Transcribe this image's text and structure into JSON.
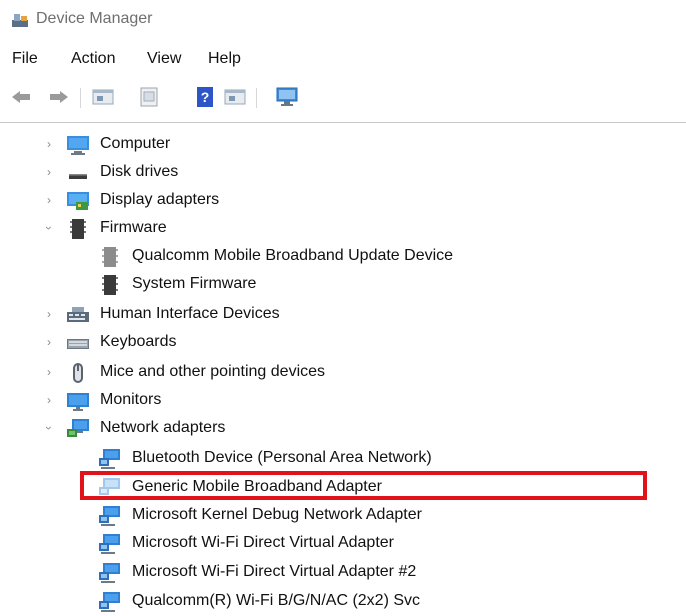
{
  "window": {
    "title": "Device Manager"
  },
  "menu": [
    "File",
    "Action",
    "View",
    "Help"
  ],
  "toolbar": [
    {
      "name": "back-arrow-icon"
    },
    {
      "name": "forward-arrow-icon"
    },
    {
      "name": "properties-icon"
    },
    {
      "name": "hide-show-console-tree-icon"
    },
    {
      "name": "help-icon"
    },
    {
      "name": "console-view-icon"
    },
    {
      "name": "scan-hardware-changes-icon"
    }
  ],
  "tree": {
    "rows": [
      {
        "label": "Computer",
        "level": 1,
        "expanded": false,
        "icon": "computer-icon"
      },
      {
        "label": "Disk drives",
        "level": 1,
        "expanded": false,
        "icon": "disk-drive-icon"
      },
      {
        "label": "Display adapters",
        "level": 1,
        "expanded": false,
        "icon": "display-adapter-icon"
      },
      {
        "label": "Firmware",
        "level": 1,
        "expanded": true,
        "icon": "firmware-icon"
      },
      {
        "label": "Qualcomm Mobile Broadband Update Device",
        "level": 2,
        "icon": "firmware-device-icon"
      },
      {
        "label": "System Firmware",
        "level": 2,
        "icon": "firmware-device-icon"
      },
      {
        "label": "Human Interface Devices",
        "level": 1,
        "expanded": false,
        "icon": "hid-icon"
      },
      {
        "label": "Keyboards",
        "level": 1,
        "expanded": false,
        "icon": "keyboard-icon"
      },
      {
        "label": "Mice and other pointing devices",
        "level": 1,
        "expanded": false,
        "icon": "mouse-icon"
      },
      {
        "label": "Monitors",
        "level": 1,
        "expanded": false,
        "icon": "monitor-icon"
      },
      {
        "label": "Network adapters",
        "level": 1,
        "expanded": true,
        "icon": "network-adapter-icon"
      },
      {
        "label": "Bluetooth Device (Personal Area Network)",
        "level": 2,
        "icon": "network-device-icon"
      },
      {
        "label": "Generic Mobile Broadband Adapter",
        "level": 2,
        "icon": "network-device-disabled-icon",
        "highlighted": true
      },
      {
        "label": "Microsoft Kernel Debug Network Adapter",
        "level": 2,
        "icon": "network-device-icon"
      },
      {
        "label": "Microsoft Wi-Fi Direct Virtual Adapter",
        "level": 2,
        "icon": "network-device-icon"
      },
      {
        "label": "Microsoft Wi-Fi Direct Virtual Adapter #2",
        "level": 2,
        "icon": "network-device-icon"
      },
      {
        "label": "Qualcomm(R) Wi-Fi B/G/N/AC (2x2) Svc",
        "level": 2,
        "icon": "network-device-icon"
      }
    ]
  },
  "colors": {
    "highlight": "#e0131a",
    "accent": "#1e78d7"
  }
}
